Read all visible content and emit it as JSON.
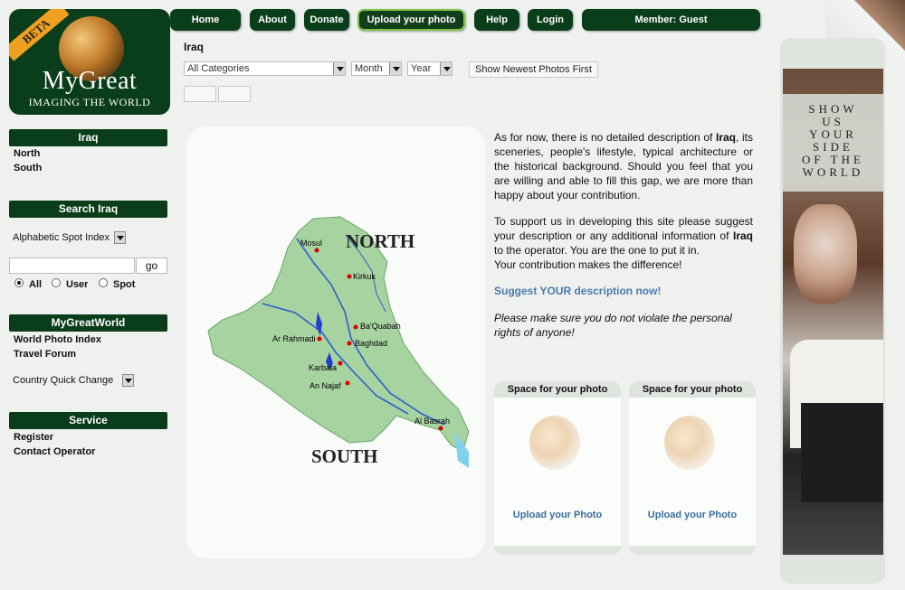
{
  "logo": {
    "beta": "BETA",
    "title": "MyGreat",
    "subtitle": "IMAGING THE WORLD"
  },
  "nav": {
    "home": "Home",
    "about": "About",
    "donate": "Donate",
    "upload": "Upload your photo",
    "help": "Help",
    "login": "Login",
    "member": "Member: Guest"
  },
  "page": {
    "title": "Iraq"
  },
  "filters": {
    "category": "All Categories",
    "month": "Month",
    "year": "Year",
    "show_newest": "Show Newest Photos First"
  },
  "sidebar": {
    "regions_header": "Iraq",
    "regions": [
      "North",
      "South"
    ],
    "search_header": "Search Iraq",
    "spot_index": "Alphabetic Spot Index",
    "go": "go",
    "radio_all": "All",
    "radio_user": "User",
    "radio_spot": "Spot",
    "mgw_header": "MyGreatWorld",
    "mgw_links": [
      "World Photo Index",
      "Travel Forum"
    ],
    "country_quick": "Country Quick Change",
    "service_header": "Service",
    "service_links": [
      "Register",
      "Contact Operator"
    ]
  },
  "map": {
    "north_label": "NORTH",
    "south_label": "SOUTH",
    "cities": [
      "Mosul",
      "Kirkuk",
      "Ba'Quabah",
      "Ar Rahmadi",
      "Baghdad",
      "Karbala",
      "An Najaf",
      "Al Basrah"
    ]
  },
  "description": {
    "p1_pre": "As for now, there is no detailed description of ",
    "p1_bold": "Iraq",
    "p1_post": ", its sceneries, people's lifestyle, typical architecture or the historical background. Should you feel that you are willing and able to fill this gap, we are more than happy about your contribution.",
    "p2_pre": "To support us in developing this site please suggest your description or any additional information of ",
    "p2_bold": "Iraq",
    "p2_post": " to the operator. You are the one to put it in.",
    "p2_line2": "Your contribution makes the difference!",
    "suggest": "Suggest YOUR description now!",
    "warning": "Please make sure you do not violate the personal rights of anyone!"
  },
  "photo_slots": [
    {
      "header": "Space for your photo",
      "link": "Upload your Photo"
    },
    {
      "header": "Space for your photo",
      "link": "Upload your Photo"
    }
  ],
  "ad": {
    "lines": [
      "SHOW",
      "US",
      "YOUR",
      "SIDE",
      "OF THE",
      "WORLD"
    ]
  }
}
